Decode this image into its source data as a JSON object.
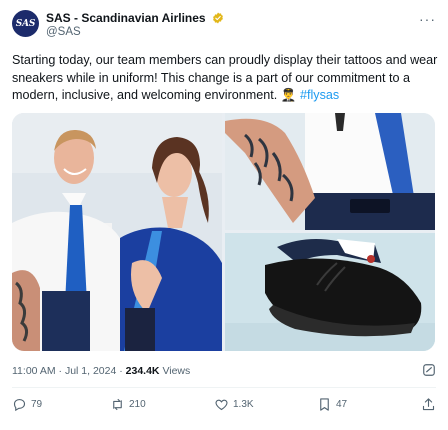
{
  "author": {
    "display_name": "SAS - Scandinavian Airlines",
    "handle": "@SAS",
    "avatar_text": "SAS",
    "verified": true
  },
  "tweet": {
    "text": "Starting today, our team members can proudly display their tattoos and wear sneakers while in uniform! This change is a part of our commitment to a modern, inclusive, and welcoming environment.",
    "emoji": "👨‍✈️",
    "hashtag": "#flysas"
  },
  "media": {
    "images": [
      "smiling-crew-members",
      "tattooed-arm-with-shirt",
      "black-sneaker"
    ]
  },
  "meta": {
    "time": "11:00 AM",
    "separator1": "·",
    "date": "Jul 1, 2024",
    "separator2": "·",
    "views_count": "234.4K",
    "views_label": "Views"
  },
  "actions": {
    "reply_count": "79",
    "repost_count": "210",
    "like_count": "1.3K",
    "bookmark_count": "47"
  },
  "colors": {
    "accent": "#1d9bf0",
    "muted": "#536471",
    "brand_navy": "#1c2b6b"
  }
}
